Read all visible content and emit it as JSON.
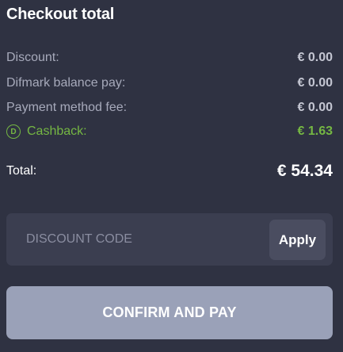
{
  "checkout": {
    "title": "Checkout total",
    "rows": [
      {
        "label": "Discount:",
        "value": "€ 0.00"
      },
      {
        "label": "Difmark balance pay:",
        "value": "€ 0.00"
      },
      {
        "label": "Payment method fee:",
        "value": "€ 0.00"
      }
    ],
    "cashback": {
      "icon_letter": "D",
      "label": "Cashback:",
      "value": "€ 1.63"
    },
    "total": {
      "label": "Total:",
      "value": "€ 54.34"
    }
  },
  "discount": {
    "placeholder": "DISCOUNT CODE",
    "value": "",
    "apply_label": "Apply"
  },
  "confirm": {
    "label": "CONFIRM AND PAY"
  },
  "colors": {
    "background": "#2f3242",
    "cashback_green": "#75b743",
    "confirm_button": "#9aa1b8"
  },
  "icons": {
    "cashback": "cashback-coin-icon"
  }
}
